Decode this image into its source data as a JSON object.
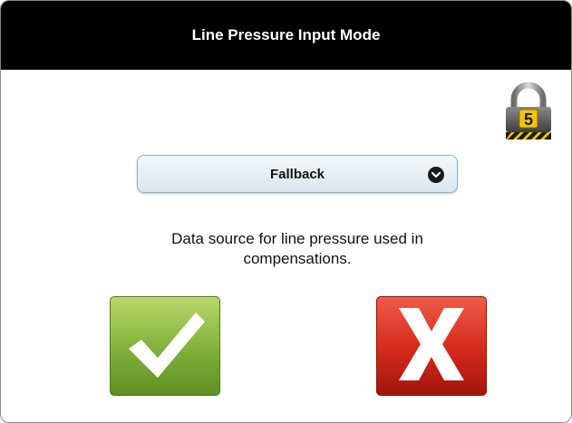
{
  "dialog": {
    "title": "Line Pressure Input Mode",
    "lock_level": "5"
  },
  "mode_select": {
    "selected": "Fallback",
    "icon": "chevron-down-icon"
  },
  "description": "Data source for line pressure used in compensations.",
  "buttons": {
    "confirm": {
      "icon": "checkmark-icon",
      "color": "#7fb03a"
    },
    "cancel": {
      "icon": "x-icon",
      "color": "#d32a1c"
    }
  }
}
